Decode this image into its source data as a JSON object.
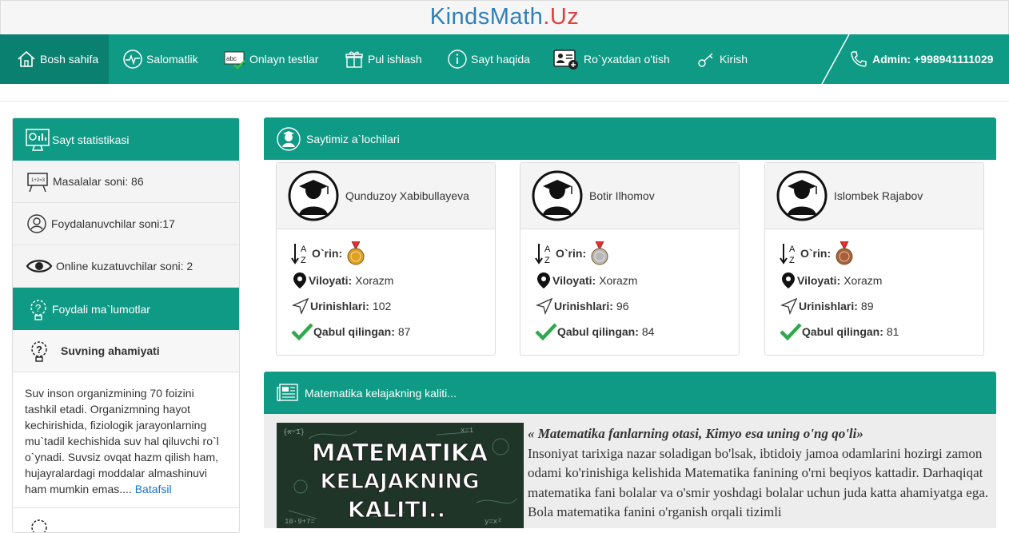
{
  "logo": {
    "part1": "KindsMath",
    "dot": ".",
    "part2": "Uz"
  },
  "nav": {
    "items": [
      {
        "label": "Bosh sahifa"
      },
      {
        "label": "Salomatlik"
      },
      {
        "label": "Onlayn testlar"
      },
      {
        "label": "Pul ishlash"
      },
      {
        "label": "Sayt haqida"
      },
      {
        "label": "Ro`yxatdan o'tish"
      },
      {
        "label": "Kirish"
      }
    ],
    "admin": "Admin: +998941111029"
  },
  "sidebar": {
    "stats_title": "Sayt statistikasi",
    "problems": "Masalalar soni: 86",
    "users": "Foydalanuvchilar soni:17",
    "online": "Online kuzatuvchilar soni: 2",
    "info_title": "Foydali ma`lumotlar",
    "article_title": "Suvning ahamiyati",
    "article_text": "Suv inson organizmining 70 foizini tashkil etadi. Organizmning hayot kechirishida, fiziologik jarayonlarning mu`tadil kechishida suv hal qiluvchi ro`l o`ynadi. Suvsiz ovqat hazm qilish ham, hujayralardagi moddalar almashinuvi ham mumkin emas....",
    "more_link": "Batafsil"
  },
  "top_students": {
    "title": "Saytimiz a`lochilari",
    "labels": {
      "rank": "O`rin:",
      "region": "Viloyati:",
      "attempts": "Urinishlari:",
      "accepted": "Qabul qilingan:"
    },
    "students": [
      {
        "name": "Qunduzoy Xabibullayeva",
        "region": "Xorazm",
        "attempts": "102",
        "accepted": "87",
        "medal_color": "#e0a020"
      },
      {
        "name": "Botir Ilhomov",
        "region": "Xorazm",
        "attempts": "96",
        "accepted": "84",
        "medal_color": "#b8b8b8"
      },
      {
        "name": "Islombek Rajabov",
        "region": "Xorazm",
        "attempts": "89",
        "accepted": "81",
        "medal_color": "#a8603a"
      }
    ]
  },
  "article": {
    "title": "Matematika kelajakning kaliti...",
    "image_lines": [
      "MATEMATIKA",
      "KELAJAKNING",
      "KALITI.."
    ],
    "quote": "« Matematika fanlarning otasi, Kimyo esa uning o'ng qo'li»",
    "text": "Insoniyat tarixiga nazar soladigan bo'lsak, ibtidoiy jamoa odamlarini hozirgi zamon odami ko'rinishiga kelishida Matematika fanining o'rni beqiyos kattadir. Darhaqiqat matematika fani bolalar va o'smir yoshdagi bolalar uchun juda katta ahamiyatga ega. Bola matematika fanini o'rganish orqali tizimli"
  },
  "colors": {
    "primary": "#0f9a85",
    "primary_dark": "#0a8170",
    "link": "#1a73c8"
  }
}
